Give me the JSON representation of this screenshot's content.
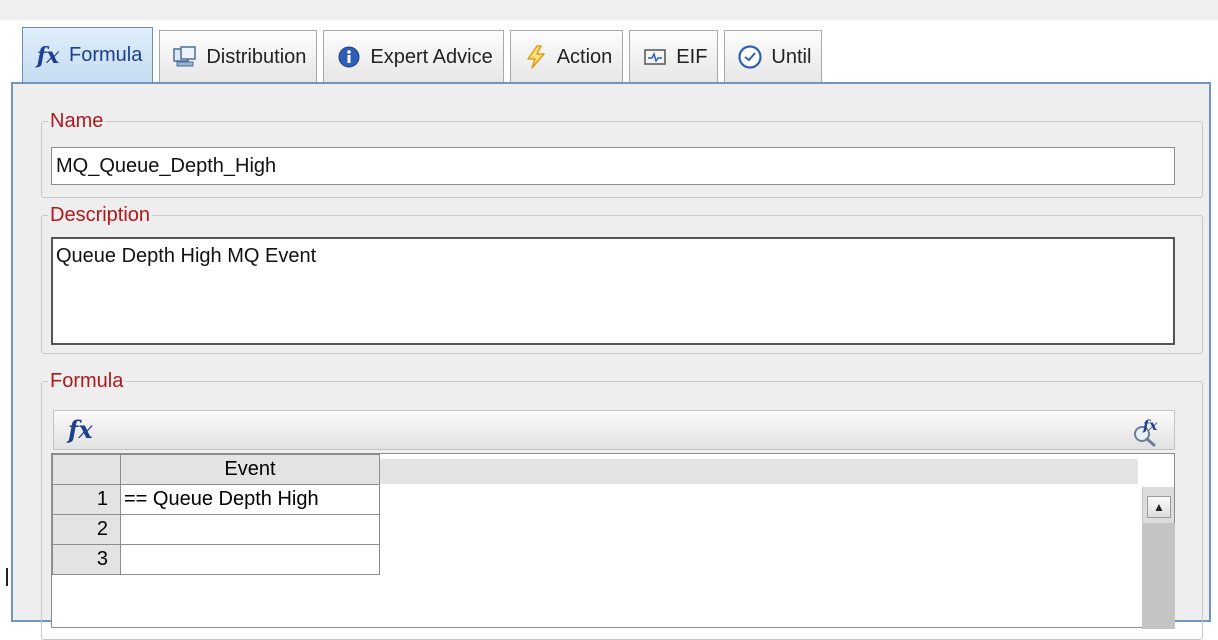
{
  "tabs": [
    {
      "label": "Formula",
      "icon": "formula-fx-icon",
      "selected": true
    },
    {
      "label": "Distribution",
      "icon": "distribution-icon",
      "selected": false
    },
    {
      "label": "Expert Advice",
      "icon": "info-icon",
      "selected": false
    },
    {
      "label": "Action",
      "icon": "lightning-icon",
      "selected": false
    },
    {
      "label": "EIF",
      "icon": "eif-icon",
      "selected": false
    },
    {
      "label": "Until",
      "icon": "clock-icon",
      "selected": false
    }
  ],
  "name": {
    "legend": "Name",
    "value": "MQ_Queue_Depth_High"
  },
  "description": {
    "legend": "Description",
    "value": "Queue Depth High MQ Event"
  },
  "formula": {
    "legend": "Formula",
    "toolbar_fx_label": "fx",
    "columns": [
      "Event"
    ],
    "rows": [
      {
        "num": "1",
        "event": "== Queue Depth High"
      },
      {
        "num": "2",
        "event": ""
      },
      {
        "num": "3",
        "event": ""
      }
    ]
  },
  "colors": {
    "legend_text": "#b3171a",
    "selected_tab_text": "#1d3f8c",
    "panel_border": "#6d97bf"
  }
}
